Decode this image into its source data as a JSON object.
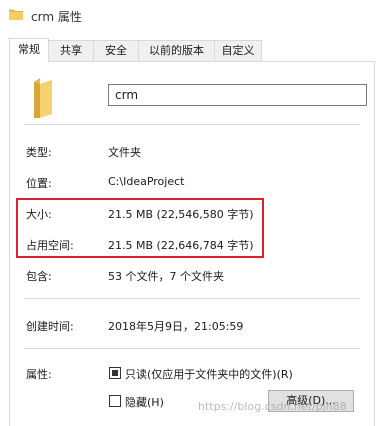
{
  "window": {
    "title": "crm 属性",
    "title_icon": "folder-icon"
  },
  "tabs": [
    {
      "label": "常规",
      "active": true
    },
    {
      "label": "共享",
      "active": false
    },
    {
      "label": "安全",
      "active": false
    },
    {
      "label": "以前的版本",
      "active": false
    },
    {
      "label": "自定义",
      "active": false
    }
  ],
  "general": {
    "folder_icon": "folder-icon",
    "name_value": "crm",
    "type_label": "类型:",
    "type_value": "文件夹",
    "location_label": "位置:",
    "location_value": "C:\\IdeaProject",
    "size_label": "大小:",
    "size_value": "21.5 MB (22,546,580 字节)",
    "disk_size_label": "占用空间:",
    "disk_size_value": "21.5 MB (22,646,784 字节)",
    "contains_label": "包含:",
    "contains_value": "53 个文件，7 个文件夹",
    "created_label": "创建时间:",
    "created_value": "2018年5月9日，21:05:59",
    "attributes_label": "属性:",
    "readonly_label": "只读(仅应用于文件夹中的文件)(R)",
    "readonly_state": "indeterminate",
    "hidden_label": "隐藏(H)",
    "hidden_state": "unchecked",
    "advanced_button": "高级(D)..."
  },
  "highlight_color": "#e0202e",
  "watermark": "https://blog.csdn.net/pjh88"
}
